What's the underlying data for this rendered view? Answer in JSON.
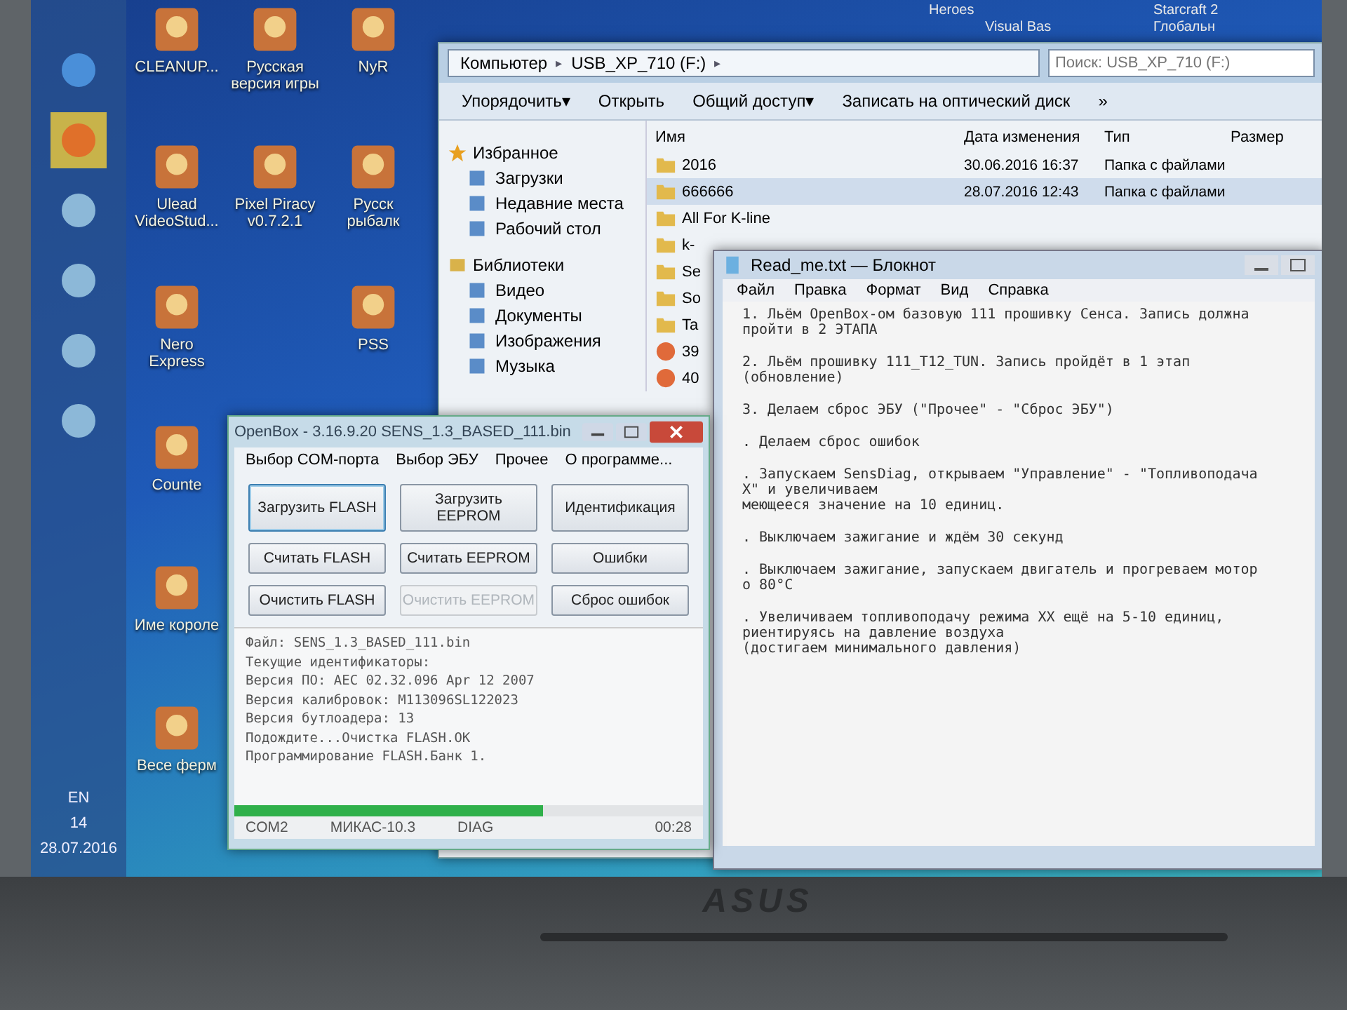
{
  "desktop": {
    "top_labels": [
      {
        "label": "Heroes"
      },
      {
        "label": "Visual Bas"
      },
      {
        "label": "Starcraft 2"
      },
      {
        "label": "Глобальн"
      }
    ],
    "icons": [
      {
        "label": "CLEANUP..."
      },
      {
        "label": "Русская версия игры"
      },
      {
        "label": "NyR"
      },
      {
        "label": "Ulead VideoStud..."
      },
      {
        "label": "Pixel Piracy v0.7.2.1"
      },
      {
        "label": "Русск рыбалк"
      },
      {
        "label": "Nero Express"
      },
      {
        "label": "PSS"
      },
      {
        "label": "Counte"
      },
      {
        "label": "Име короле"
      },
      {
        "label": "Весе ферм"
      }
    ]
  },
  "taskbar": {
    "language": "EN",
    "clock_time": "14",
    "clock_date": "28.07.2016"
  },
  "explorer": {
    "address": [
      {
        "label": "Компьютер",
        "kind": "crumb"
      },
      {
        "label": "▸",
        "kind": "separator"
      },
      {
        "label": "USB_XP_710 (F:)",
        "kind": "crumb"
      },
      {
        "label": "▸",
        "kind": "separator"
      }
    ],
    "search": {
      "placeholder": "Поиск: USB_XP_710 (F:)"
    },
    "toolbar": [
      {
        "label": "Упорядочить",
        "caret": "▾"
      },
      {
        "label": "Открыть"
      },
      {
        "label": "Общий доступ",
        "caret": "▾"
      },
      {
        "label": "Записать на оптический диск"
      },
      {
        "label": "»"
      }
    ],
    "sidebar": [
      {
        "label": "Избранное",
        "children": [
          {
            "label": "Загрузки"
          },
          {
            "label": "Недавние места"
          },
          {
            "label": "Рабочий стол"
          }
        ]
      },
      {
        "label": "Библиотеки",
        "children": [
          {
            "label": "Видео"
          },
          {
            "label": "Документы"
          },
          {
            "label": "Изображения"
          },
          {
            "label": "Музыка"
          }
        ]
      }
    ],
    "columns": [
      "Имя",
      "Дата изменения",
      "Тип",
      "Размер"
    ],
    "rows": [
      {
        "name": "2016",
        "date": "30.06.2016 16:37",
        "type": "Папка с файлами",
        "kind": "folder",
        "selected": false
      },
      {
        "name": "666666",
        "date": "28.07.2016 12:43",
        "type": "Папка с файлами",
        "kind": "folder",
        "selected": true
      },
      {
        "name": "All For K-line",
        "kind": "folder",
        "selected": false
      },
      {
        "name": "k-",
        "kind": "folder",
        "selected": false
      },
      {
        "name": "Se",
        "kind": "folder",
        "selected": false
      },
      {
        "name": "So",
        "kind": "folder",
        "selected": false
      },
      {
        "name": "Ta",
        "kind": "folder",
        "selected": false
      },
      {
        "name": "39",
        "kind": "app",
        "selected": false
      },
      {
        "name": "40",
        "kind": "app",
        "selected": false
      }
    ]
  },
  "notepad": {
    "title": "Read_me.txt — Блокнот",
    "menu": [
      "Файл",
      "Правка",
      "Формат",
      "Вид",
      "Справка"
    ],
    "paragraphs": [
      [
        "1. Льём OpenBox-ом базовую 111 прошивку Сенса. Запись должна",
        "пройти в 2 ЭТАПА"
      ],
      [
        "2. Льём прошивку 111_T12_TUN. Запись пройдёт в 1 этап",
        "(обновление)"
      ],
      [
        "3. Делаем сброс ЭБУ (\"Прочее\" - \"Сброс ЭБУ\")"
      ],
      [
        ". Делаем сброс ошибок"
      ],
      [
        ". Запускаем SensDiag, открываем \"Управление\" - \"Топливоподача",
        "X\" и увеличиваем",
        "меющееся значение на 10 единиц."
      ],
      [
        ". Выключаем зажигание и ждём 30 секунд"
      ],
      [
        ". Выключаем зажигание, запускаем двигатель и прогреваем мотор",
        "о 80°C"
      ],
      [
        ". Увеличиваем топливоподачу режима ХХ ещё на 5-10 единиц,",
        "риентируясь на давление воздуха",
        "(достигаем минимального давления)"
      ]
    ]
  },
  "openbox": {
    "title": "OpenBox - 3.16.9.20 SENS_1.3_BASED_111.bin",
    "menu": [
      "Выбор COM-порта",
      "Выбор ЭБУ",
      "Прочее",
      "О программе..."
    ],
    "buttons": [
      {
        "label": "Загрузить FLASH",
        "disabled": false,
        "focused": true
      },
      {
        "label": "Загрузить EEPROM",
        "disabled": false,
        "focused": false
      },
      {
        "label": "Идентификация",
        "disabled": false,
        "focused": false
      },
      {
        "label": "Считать FLASH",
        "disabled": false,
        "focused": false
      },
      {
        "label": "Считать EEPROM",
        "disabled": false,
        "focused": false
      },
      {
        "label": "Ошибки",
        "disabled": false,
        "focused": false
      },
      {
        "label": "Очистить FLASH",
        "disabled": false,
        "focused": false
      },
      {
        "label": "Очистить EEPROM",
        "disabled": true,
        "focused": false
      },
      {
        "label": "Сброс ошибок",
        "disabled": false,
        "focused": false
      }
    ],
    "log": [
      "Файл: SENS_1.3_BASED_111.bin",
      "Текущие идентификаторы:",
      "Версия ПО: AEC 02.32.096  Apr 12 2007",
      "Версия калибровок: M113096SL122023",
      "Версия бутлоадера: 13",
      "Подождите...Очистка FLASH.OK",
      "Программирование FLASH.Банк 1."
    ],
    "progress": {
      "level": 0.66
    },
    "status": [
      "COM2",
      "МИКАС-10.3",
      "DIAG",
      "00:28"
    ]
  },
  "laptop": {
    "brand": "ASUS"
  }
}
